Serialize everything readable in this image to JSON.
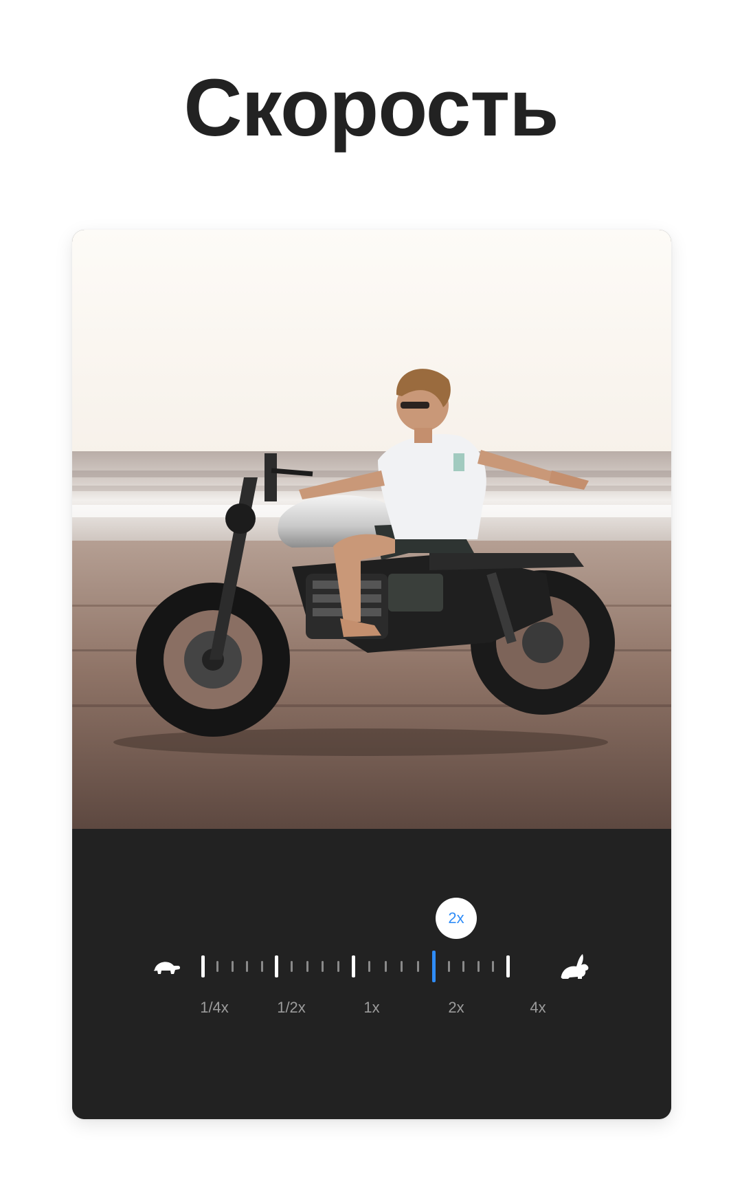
{
  "title": "Скорость",
  "speed_control": {
    "current_value": "2x",
    "slow_icon": "turtle-icon",
    "fast_icon": "rabbit-icon",
    "options": [
      "1/4x",
      "1/2x",
      "1x",
      "2x",
      "4x"
    ],
    "selected_index": 3,
    "accent_color": "#2f8cf7"
  },
  "colors": {
    "panel": "#222222",
    "title": "#222222",
    "tick_major": "#ffffff",
    "tick_minor": "#8a8a8a",
    "label": "#9c9c9c"
  }
}
